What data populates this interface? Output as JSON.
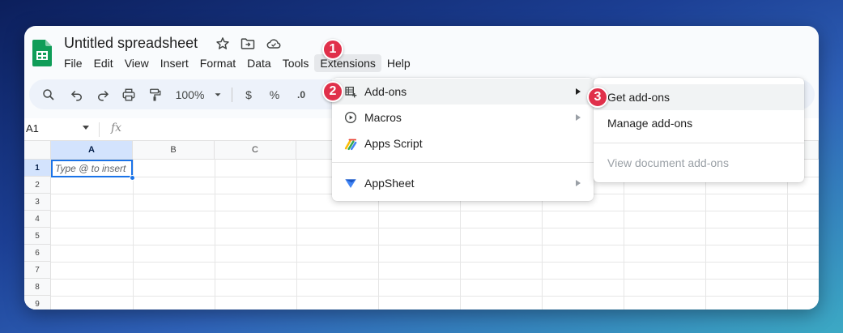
{
  "app": {
    "title": "Untitled spreadsheet",
    "icons": [
      "star-icon",
      "move-to-folder-icon",
      "cloud-saved-icon"
    ]
  },
  "menubar": {
    "items": [
      "File",
      "Edit",
      "View",
      "Insert",
      "Format",
      "Data",
      "Tools",
      "Extensions",
      "Help"
    ],
    "active": "Extensions"
  },
  "toolbar": {
    "zoom": "100%",
    "currency": "$",
    "percent": "%",
    "decimal_decrease": ".0"
  },
  "formula_bar": {
    "cell_ref": "A1",
    "fx": "fx"
  },
  "grid": {
    "columns": [
      "A",
      "B",
      "C"
    ],
    "rows": [
      "1",
      "2",
      "3",
      "4",
      "5",
      "6",
      "7",
      "8",
      "9"
    ],
    "active_cell_placeholder": "Type @ to insert"
  },
  "extensions_menu": {
    "items": [
      {
        "label": "Add-ons",
        "icon": "add-ons-icon",
        "submenu": true
      },
      {
        "label": "Macros",
        "icon": "macros-play-icon",
        "submenu": true
      },
      {
        "label": "Apps Script",
        "icon": "apps-script-icon",
        "submenu": false
      },
      {
        "label": "AppSheet",
        "icon": "appsheet-icon",
        "submenu": true
      }
    ]
  },
  "addons_submenu": {
    "items": [
      {
        "label": "Get add-ons",
        "disabled": false
      },
      {
        "label": "Manage add-ons",
        "disabled": false
      },
      {
        "label": "View document add-ons",
        "disabled": true
      }
    ]
  },
  "step_badges": [
    "1",
    "2",
    "3"
  ],
  "colors": {
    "accent": "#1a73e8",
    "badge": "#e0304a",
    "sheets_green": "#0f9d58",
    "toolbar_bg": "#edf2fa"
  }
}
